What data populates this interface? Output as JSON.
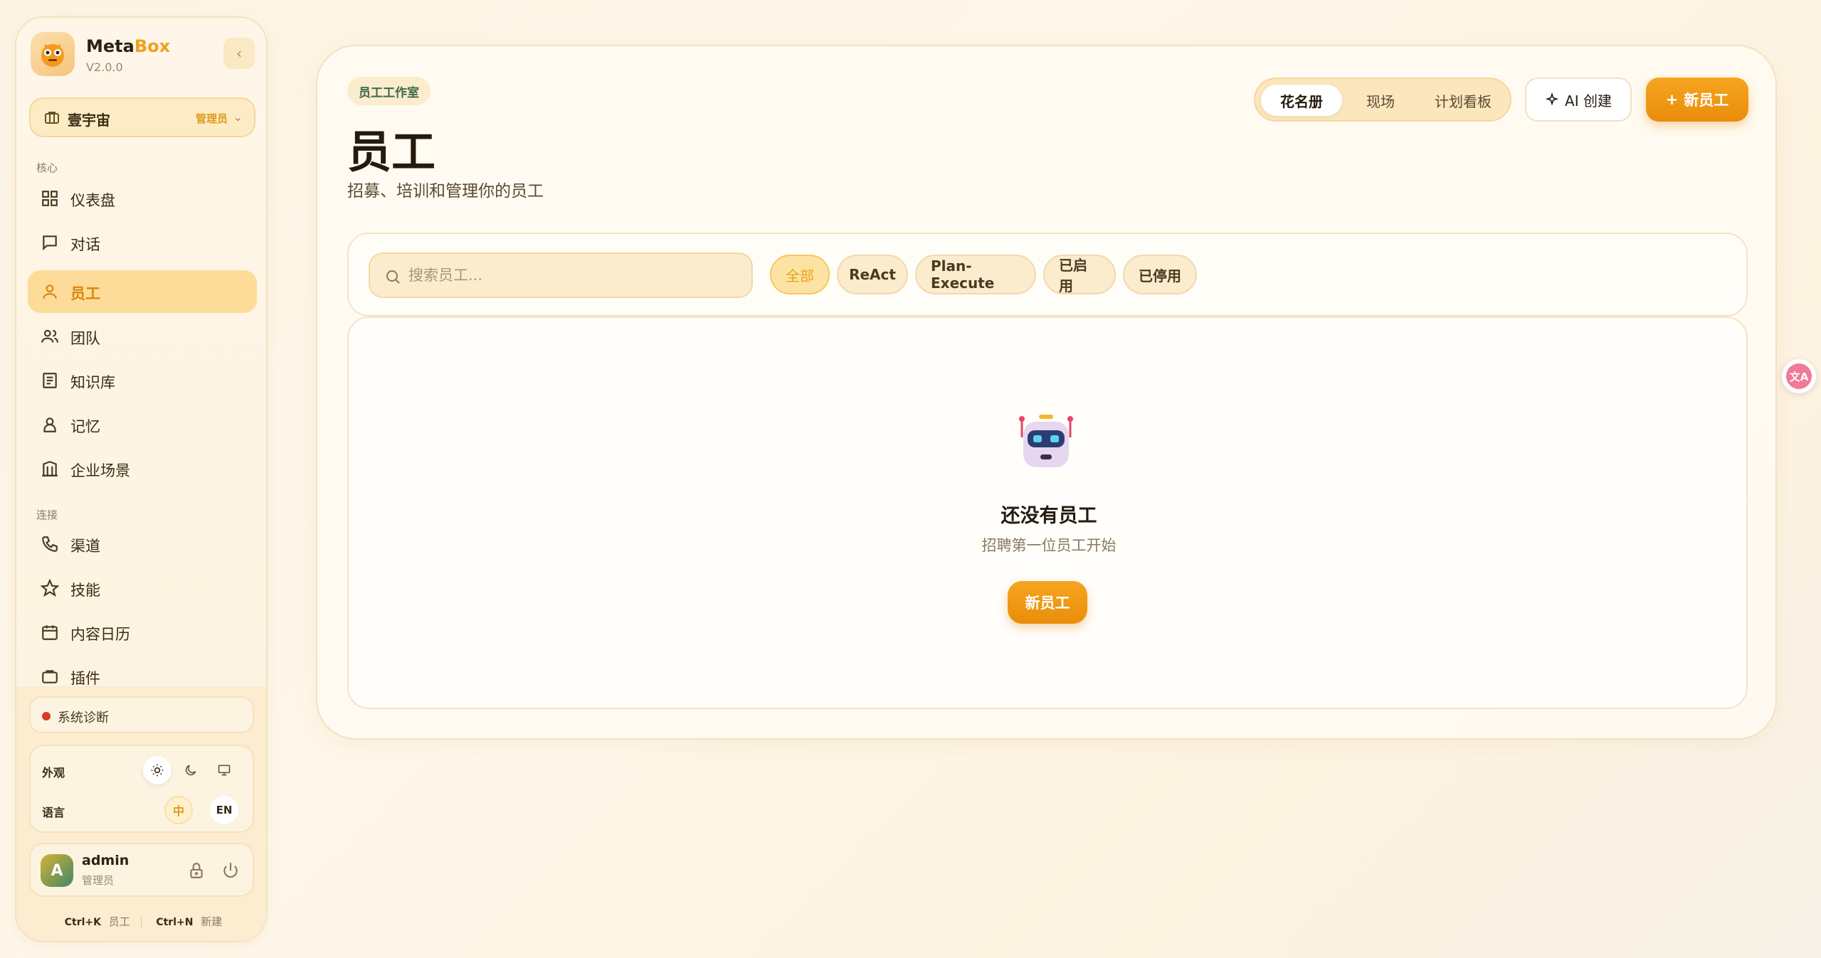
{
  "brand": {
    "name_main": "Meta",
    "name_accent": "Box",
    "version": "V2.0.0"
  },
  "workspace": {
    "name": "壹宇宙",
    "role": "管理员"
  },
  "sidebar": {
    "section_core": "核心",
    "section_connect": "连接",
    "items": [
      {
        "label": "仪表盘",
        "icon": "dashboard-icon"
      },
      {
        "label": "对话",
        "icon": "chat-icon"
      },
      {
        "label": "员工",
        "icon": "employee-icon"
      },
      {
        "label": "团队",
        "icon": "team-icon"
      },
      {
        "label": "知识库",
        "icon": "knowledge-icon"
      },
      {
        "label": "记忆",
        "icon": "memory-icon"
      },
      {
        "label": "企业场景",
        "icon": "building-icon"
      },
      {
        "label": "渠道",
        "icon": "phone-icon"
      },
      {
        "label": "技能",
        "icon": "star-icon"
      },
      {
        "label": "内容日历",
        "icon": "calendar-icon"
      },
      {
        "label": "插件",
        "icon": "plugin-icon"
      }
    ],
    "active_item": "员工"
  },
  "diagnostics": {
    "label": "系统诊断",
    "status_color": "#d93a2b"
  },
  "prefs": {
    "appearance_label": "外观",
    "language_label": "语言",
    "lang_zh": "中",
    "lang_en": "EN"
  },
  "user": {
    "name": "admin",
    "role": "管理员",
    "avatar_letter": "A"
  },
  "shortcuts": {
    "k_key": "Ctrl+K",
    "k_label": "员工",
    "n_key": "Ctrl+N",
    "n_label": "新建"
  },
  "header": {
    "crumb": "员工工作室",
    "title": "员工",
    "subtitle": "招募、培训和管理你的员工",
    "view_tabs": [
      "花名册",
      "现场",
      "计划看板"
    ],
    "active_tab": "花名册",
    "ai_create": "AI 创建",
    "new_employee": "新员工"
  },
  "filters": {
    "search_placeholder": "搜索员工...",
    "chips": [
      "全部",
      "ReAct",
      "Plan-Execute",
      "已启用",
      "已停用"
    ],
    "active_chip": "全部"
  },
  "empty": {
    "title": "还没有员工",
    "subtitle": "招聘第一位员工开始",
    "button": "新员工"
  },
  "colors": {
    "accent": "#f0a020",
    "primary_button": "#e98d0a"
  }
}
